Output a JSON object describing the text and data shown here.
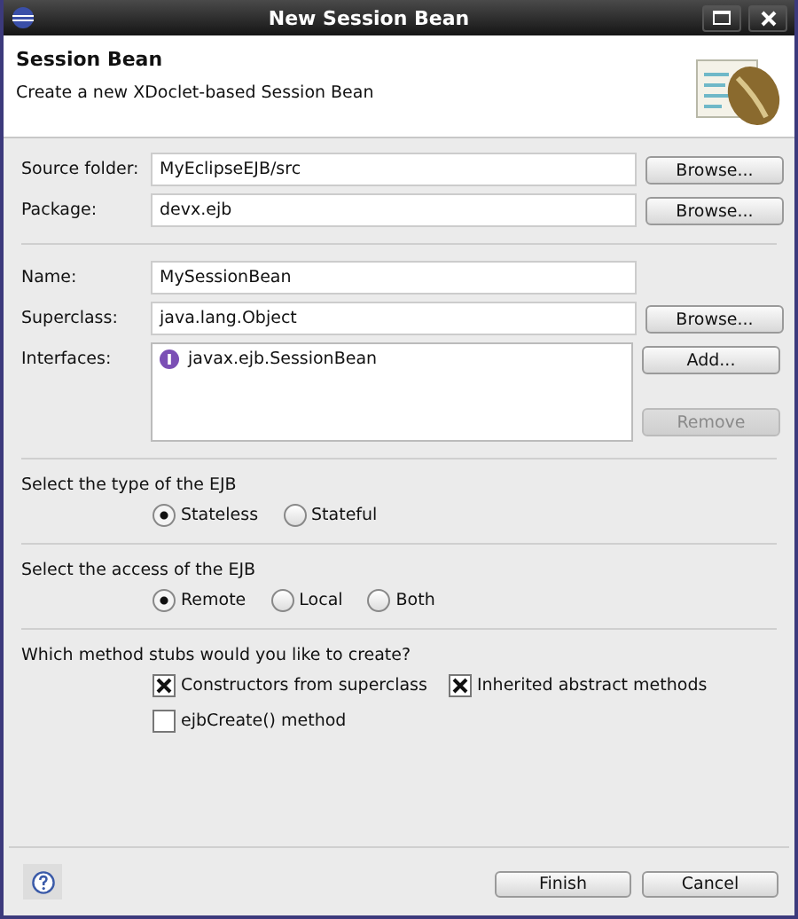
{
  "window": {
    "title": "New Session Bean"
  },
  "header": {
    "title": "Session Bean",
    "description": "Create a new XDoclet-based Session Bean"
  },
  "field_groups": [
    [
      {
        "kind": "text",
        "label": "Source folder:",
        "value": "MyEclipseEJB/src",
        "buttons": [
          {
            "label": "Browse...",
            "disabled": false
          }
        ]
      },
      {
        "kind": "text",
        "label": "Package:",
        "value": "devx.ejb",
        "buttons": [
          {
            "label": "Browse...",
            "disabled": false
          }
        ]
      }
    ],
    [
      {
        "kind": "text",
        "label": "Name:",
        "value": "MySessionBean"
      },
      {
        "kind": "text",
        "label": "Superclass:",
        "value": "java.lang.Object",
        "buttons": [
          {
            "label": "Browse...",
            "disabled": false
          }
        ]
      },
      {
        "kind": "list",
        "label": "Interfaces:",
        "items": [
          {
            "label": "javax.ejb.SessionBean"
          }
        ],
        "buttons": [
          {
            "label": "Add...",
            "disabled": false
          },
          {
            "label": "Remove",
            "disabled": true
          }
        ]
      }
    ]
  ],
  "option_groups": [
    {
      "kind": "radio",
      "label": "Select the type of the EJB",
      "options": [
        {
          "label": "Stateless",
          "selected": true
        },
        {
          "label": "Stateful",
          "selected": false
        }
      ]
    },
    {
      "kind": "radio",
      "label": "Select the access of the EJB",
      "options": [
        {
          "label": "Remote",
          "selected": true
        },
        {
          "label": "Local",
          "selected": false
        },
        {
          "label": "Both",
          "selected": false
        }
      ]
    },
    {
      "kind": "checkbox",
      "label": "Which method stubs would you like to create?",
      "options": [
        {
          "label": "Constructors from superclass",
          "checked": true
        },
        {
          "label": "Inherited abstract methods",
          "checked": true
        },
        {
          "label": "ejbCreate() method",
          "checked": false
        }
      ]
    }
  ],
  "footer": {
    "buttons": [
      {
        "label": "Finish"
      },
      {
        "label": "Cancel"
      }
    ]
  }
}
